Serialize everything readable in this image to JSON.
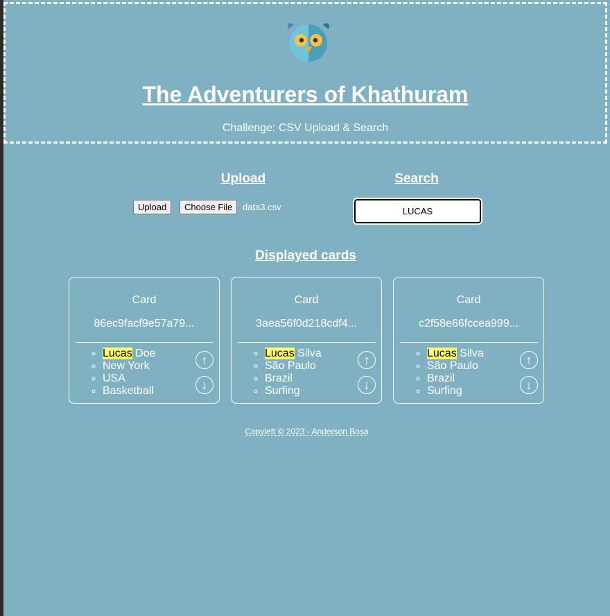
{
  "header": {
    "title": "The Adventurers of Khathuram",
    "subtitle": "Challenge: CSV Upload & Search"
  },
  "upload": {
    "heading": "Upload",
    "upload_button": "Upload",
    "choose_file_button": "Choose File",
    "filename": "data3.csv"
  },
  "search": {
    "heading": "Search",
    "value": "LUCAS"
  },
  "displayed": {
    "heading": "Displayed cards"
  },
  "cards": [
    {
      "title": "Card",
      "id": "86ec9facf9e57a79...",
      "highlight": "Lucas",
      "name_rest": " Doe",
      "city": "New York",
      "country": "USA",
      "sport": "Basketball"
    },
    {
      "title": "Card",
      "id": "3aea56f0d218cdf4...",
      "highlight": "Lucas",
      "name_rest": " Silva",
      "city": "São Paulo",
      "country": "Brazil",
      "sport": "Surfing"
    },
    {
      "title": "Card",
      "id": "c2f58e66fccea999...",
      "highlight": "Lucas",
      "name_rest": " Silva",
      "city": "São Paulo",
      "country": "Brazil",
      "sport": "Surfing"
    }
  ],
  "arrows": {
    "up": "↑",
    "down": "↓"
  },
  "footer": "Copyleft © 2023 - Anderson Bosa",
  "colors": {
    "background": "#7fb1c3",
    "highlight": "#ffff66",
    "border": "#ffffff"
  },
  "icons": {
    "logo": "owl-logo-icon"
  }
}
